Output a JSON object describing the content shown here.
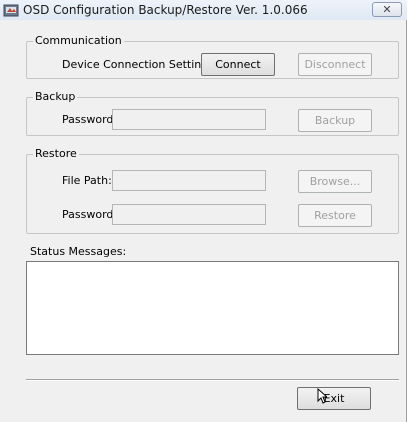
{
  "window": {
    "title": "OSD Configuration Backup/Restore   Ver. 1.0.066",
    "close_glyph": "✕",
    "app_icon": "app-icon"
  },
  "communication": {
    "legend": "Communication",
    "device_label": "Device Connection Setting:",
    "connect_label": "Connect",
    "disconnect_label": "Disconnect"
  },
  "backup": {
    "legend": "Backup",
    "password_label": "Password:",
    "password_value": "",
    "backup_label": "Backup"
  },
  "restore": {
    "legend": "Restore",
    "file_path_label": "File Path:",
    "file_path_value": "",
    "browse_label": "Browse...",
    "password_label": "Password:",
    "password_value": "",
    "restore_label": "Restore"
  },
  "status": {
    "label": "Status Messages:",
    "messages": ""
  },
  "footer": {
    "exit_label": "Exit"
  }
}
